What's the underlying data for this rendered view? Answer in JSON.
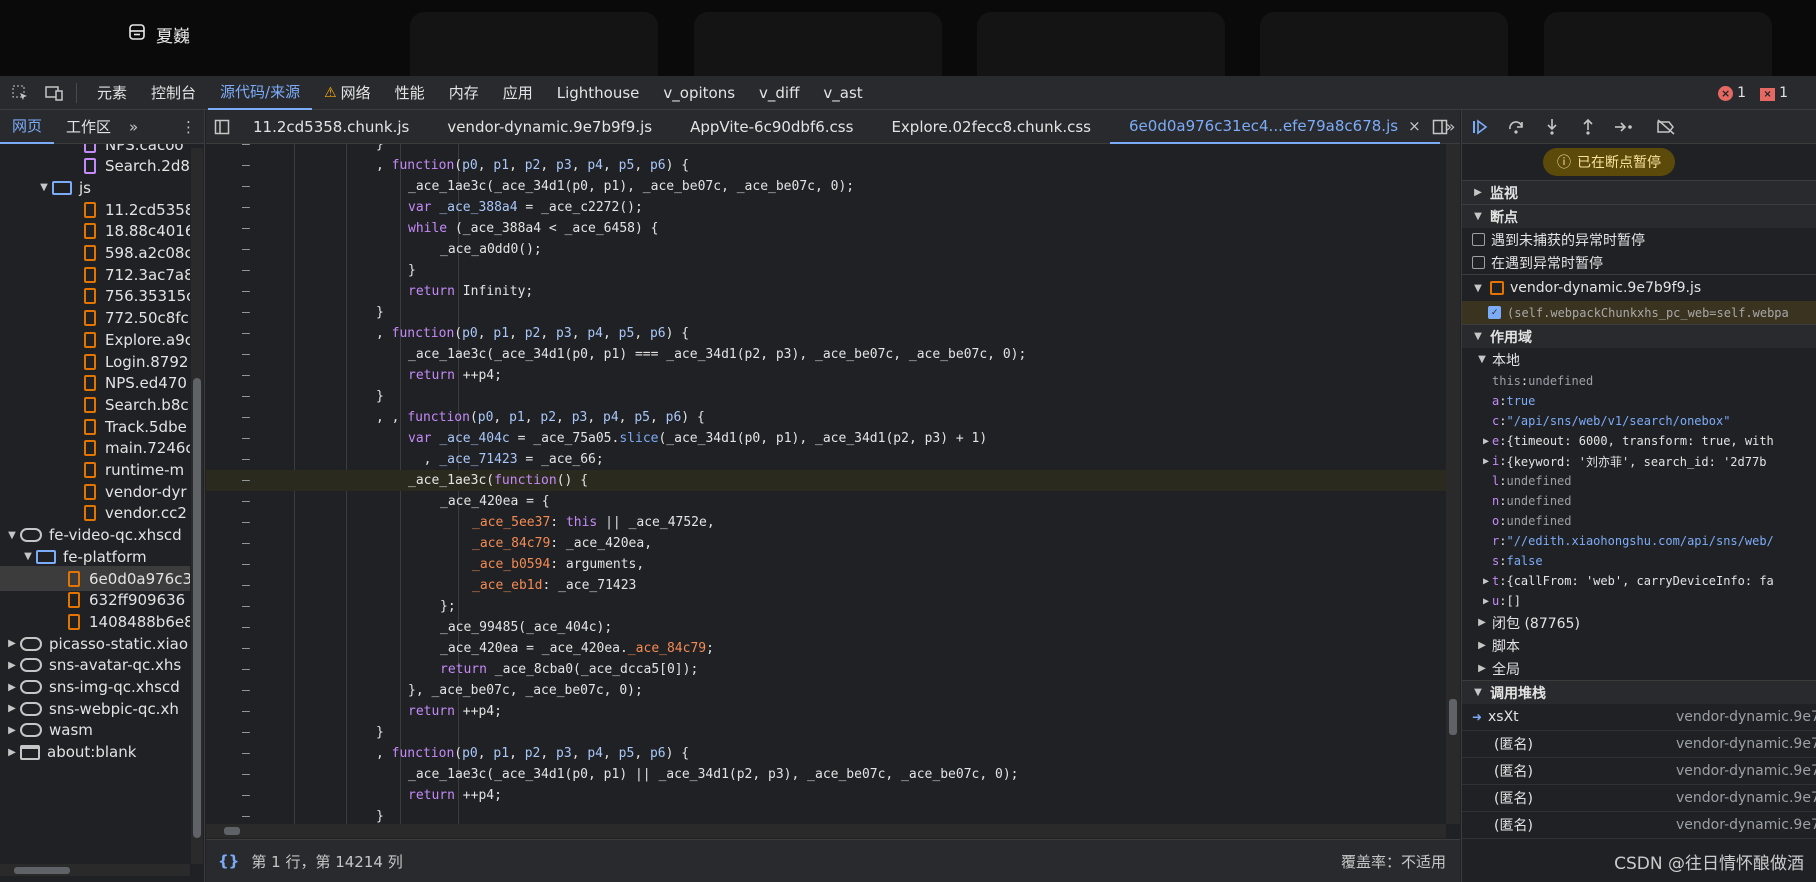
{
  "app": {
    "title": "夏巍"
  },
  "devtools": {
    "tabs": [
      "元素",
      "控制台",
      "源代码/来源",
      "网络",
      "性能",
      "内存",
      "应用",
      "Lighthouse",
      "v_opitons",
      "v_diff",
      "v_ast"
    ],
    "active_tab": "源代码/来源",
    "error_count": "1",
    "issue_count": "1"
  },
  "navigator": {
    "tabs": [
      "网页",
      "工作区"
    ],
    "tree": [
      {
        "label": "NPS.cacoo",
        "type": "css",
        "indent": 84
      },
      {
        "label": "Search.2d8",
        "type": "css",
        "indent": 84
      },
      {
        "label": "js",
        "type": "folder",
        "indent": 52,
        "arrow": "▼"
      },
      {
        "label": "11.2cd5358",
        "type": "js",
        "indent": 84
      },
      {
        "label": "18.88c4016",
        "type": "js",
        "indent": 84
      },
      {
        "label": "598.a2c08c",
        "type": "js",
        "indent": 84
      },
      {
        "label": "712.3ac7a8",
        "type": "js",
        "indent": 84
      },
      {
        "label": "756.35315c",
        "type": "js",
        "indent": 84
      },
      {
        "label": "772.50c8fc",
        "type": "js",
        "indent": 84
      },
      {
        "label": "Explore.a9c",
        "type": "js",
        "indent": 84
      },
      {
        "label": "Login.8792",
        "type": "js",
        "indent": 84
      },
      {
        "label": "NPS.ed470",
        "type": "js",
        "indent": 84
      },
      {
        "label": "Search.b8c",
        "type": "js",
        "indent": 84
      },
      {
        "label": "Track.5dbe",
        "type": "js",
        "indent": 84
      },
      {
        "label": "main.7246c",
        "type": "js",
        "indent": 84
      },
      {
        "label": "runtime-m",
        "type": "js",
        "indent": 84
      },
      {
        "label": "vendor-dyr",
        "type": "js",
        "indent": 84
      },
      {
        "label": "vendor.cc2",
        "type": "js",
        "indent": 84
      },
      {
        "label": "fe-video-qc.xhscd",
        "type": "cloud",
        "indent": 20,
        "arrow": "▼"
      },
      {
        "label": "fe-platform",
        "type": "folder",
        "indent": 36,
        "arrow": "▼"
      },
      {
        "label": "6e0d0a976c3",
        "type": "js",
        "indent": 68,
        "selected": true
      },
      {
        "label": "632ff909636",
        "type": "js",
        "indent": 68
      },
      {
        "label": "1408488b6e8",
        "type": "js",
        "indent": 68
      },
      {
        "label": "picasso-static.xiao",
        "type": "cloud",
        "indent": 20,
        "arrow": "▶"
      },
      {
        "label": "sns-avatar-qc.xhs",
        "type": "cloud",
        "indent": 20,
        "arrow": "▶"
      },
      {
        "label": "sns-img-qc.xhscd",
        "type": "cloud",
        "indent": 20,
        "arrow": "▶"
      },
      {
        "label": "sns-webpic-qc.xh",
        "type": "cloud",
        "indent": 20,
        "arrow": "▶"
      },
      {
        "label": "wasm",
        "type": "cloud",
        "indent": 20,
        "arrow": "▶"
      },
      {
        "label": "about:blank",
        "type": "frame",
        "indent": 20,
        "arrow": "▶"
      }
    ]
  },
  "editor": {
    "file_tabs": [
      "11.2cd5358.chunk.js",
      "vendor-dynamic.9e7b9f9.js",
      "AppVite-6c90dbf6.css",
      "Explore.02fecc8.chunk.css",
      "6e0d0a976c31ec4...efe79a8c678.js"
    ],
    "active_file": "6e0d0a976c31ec4...efe79a8c678.js",
    "lines": [
      {
        "indent": 0,
        "html": "<span>}</span>"
      },
      {
        "indent": 0,
        "html": ", <span class='k'>function</span>(<span class='n'>p0</span>, <span class='n'>p1</span>, <span class='n'>p2</span>, <span class='n'>p3</span>, <span class='n'>p4</span>, <span class='n'>p5</span>, <span class='n'>p6</span>) {"
      },
      {
        "indent": 1,
        "html": "_ace_1ae3c(_ace_34d1(p0, p1), _ace_be07c, _ace_be07c, 0);"
      },
      {
        "indent": 1,
        "html": "<span class='k'>var</span> <span class='n'>_ace_388a4</span> = _ace_c2272();"
      },
      {
        "indent": 1,
        "html": "<span class='k'>while</span> (_ace_388a4 &lt; _ace_6458) {"
      },
      {
        "indent": 2,
        "html": "_ace_a0dd0();"
      },
      {
        "indent": 1,
        "html": "}"
      },
      {
        "indent": 1,
        "html": "<span class='k'>return</span> Infinity;"
      },
      {
        "indent": 0,
        "html": "}"
      },
      {
        "indent": 0,
        "html": ", <span class='k'>function</span>(<span class='n'>p0</span>, <span class='n'>p1</span>, <span class='n'>p2</span>, <span class='n'>p3</span>, <span class='n'>p4</span>, <span class='n'>p5</span>, <span class='n'>p6</span>) {"
      },
      {
        "indent": 1,
        "html": "_ace_1ae3c(_ace_34d1(p0, p1) === _ace_34d1(p2, p3), _ace_be07c, _ace_be07c, 0);"
      },
      {
        "indent": 1,
        "html": "<span class='k'>return</span> ++p4;"
      },
      {
        "indent": 0,
        "html": "}"
      },
      {
        "indent": 0,
        "html": ", , <span class='k'>function</span>(<span class='n'>p0</span>, <span class='n'>p1</span>, <span class='n'>p2</span>, <span class='n'>p3</span>, <span class='n'>p4</span>, <span class='n'>p5</span>, <span class='n'>p6</span>) {"
      },
      {
        "indent": 1,
        "html": "<span class='k'>var</span> <span class='n'>_ace_404c</span> = _ace_75a05.<span class='f'>slice</span>(_ace_34d1(p0, p1), _ace_34d1(p2, p3) + 1)"
      },
      {
        "indent": 1,
        "html": "  , <span class='n'>_ace_71423</span> = _ace_66;"
      },
      {
        "indent": 1,
        "html": "_ace_1ae3c(<span class='k'>function</span>() {",
        "current": true
      },
      {
        "indent": 2,
        "html": "_ace_420ea = {"
      },
      {
        "indent": 3,
        "html": "<span class='s'>_ace_5ee37</span>: <span class='k'>this</span> || _ace_4752e,"
      },
      {
        "indent": 3,
        "html": "<span class='s'>_ace_84c79</span>: _ace_420ea,"
      },
      {
        "indent": 3,
        "html": "<span class='s'>_ace_b0594</span>: arguments,"
      },
      {
        "indent": 3,
        "html": "<span class='s'>_ace_eb1d</span>: _ace_71423"
      },
      {
        "indent": 2,
        "html": "};"
      },
      {
        "indent": 2,
        "html": "_ace_99485(_ace_404c);"
      },
      {
        "indent": 2,
        "html": "_ace_420ea = _ace_420ea.<span class='s'>_ace_84c79</span>;"
      },
      {
        "indent": 2,
        "html": "<span class='k'>return</span> _ace_8cba0(_ace_dcca5[0]);"
      },
      {
        "indent": 1,
        "html": "}, _ace_be07c, _ace_be07c, 0);"
      },
      {
        "indent": 1,
        "html": "<span class='k'>return</span> ++p4;"
      },
      {
        "indent": 0,
        "html": "}"
      },
      {
        "indent": 0,
        "html": ", <span class='k'>function</span>(<span class='n'>p0</span>, <span class='n'>p1</span>, <span class='n'>p2</span>, <span class='n'>p3</span>, <span class='n'>p4</span>, <span class='n'>p5</span>, <span class='n'>p6</span>) {"
      },
      {
        "indent": 1,
        "html": "_ace_1ae3c(_ace_34d1(p0, p1) || _ace_34d1(p2, p3), _ace_be07c, _ace_be07c, 0);"
      },
      {
        "indent": 1,
        "html": "<span class='k'>return</span> ++p4;"
      },
      {
        "indent": 0,
        "html": "}"
      }
    ],
    "status": {
      "position": "第 1 行，第 14214 列",
      "coverage": "覆盖率：不适用"
    }
  },
  "debugger": {
    "paused_label": "已在断点暂停",
    "sections": {
      "watch": "监视",
      "breakpoints": "断点",
      "scope": "作用域",
      "callstack": "调用堆栈"
    },
    "breakpoint_options": [
      "遇到未捕获的异常时暂停",
      "在遇到异常时暂停"
    ],
    "breakpoint_file": "vendor-dynamic.9e7b9f9.js",
    "breakpoint_code": "(self.webpackChunkxhs_pc_web=self.webpa",
    "scope_local": "本地",
    "scope_vars": [
      {
        "arrow": "",
        "key": "this",
        "val": "undefined",
        "cls": "sv-und",
        "plainkey": true
      },
      {
        "arrow": "",
        "key": "a",
        "val": "true",
        "cls": "sv-kw"
      },
      {
        "arrow": "",
        "key": "c",
        "val": "\"/api/sns/web/v1/search/onebox\"",
        "cls": "sv-str"
      },
      {
        "arrow": "▶",
        "key": "e",
        "val": "{timeout: 6000, transform: true, with",
        "cls": "sv-obj"
      },
      {
        "arrow": "▶",
        "key": "i",
        "val": "{keyword: '刘亦菲', search_id: '2d77b",
        "cls": "sv-obj"
      },
      {
        "arrow": "",
        "key": "l",
        "val": "undefined",
        "cls": "sv-und"
      },
      {
        "arrow": "",
        "key": "n",
        "val": "undefined",
        "cls": "sv-und"
      },
      {
        "arrow": "",
        "key": "o",
        "val": "undefined",
        "cls": "sv-und"
      },
      {
        "arrow": "",
        "key": "r",
        "val": "\"//edith.xiaohongshu.com/api/sns/web/",
        "cls": "sv-str"
      },
      {
        "arrow": "",
        "key": "s",
        "val": "false",
        "cls": "sv-kw"
      },
      {
        "arrow": "▶",
        "key": "t",
        "val": "{callFrom: 'web', carryDeviceInfo: fa",
        "cls": "sv-obj"
      },
      {
        "arrow": "▶",
        "key": "u",
        "val": "[]",
        "cls": "sv-obj"
      }
    ],
    "scope_groups": [
      "闭包 (87765)",
      "脚本",
      "全局"
    ],
    "callstack": [
      {
        "fn": "xsXt",
        "loc": "vendor-dynamic.9e7",
        "current": true
      },
      {
        "fn": "(匿名)",
        "loc": "vendor-dynamic.9e7"
      },
      {
        "fn": "(匿名)",
        "loc": "vendor-dynamic.9e7"
      },
      {
        "fn": "(匿名)",
        "loc": "vendor-dynamic.9e7"
      },
      {
        "fn": "(匿名)",
        "loc": "vendor-dynamic.9e7"
      }
    ]
  },
  "watermark": "CSDN @往日情怀酿做酒"
}
